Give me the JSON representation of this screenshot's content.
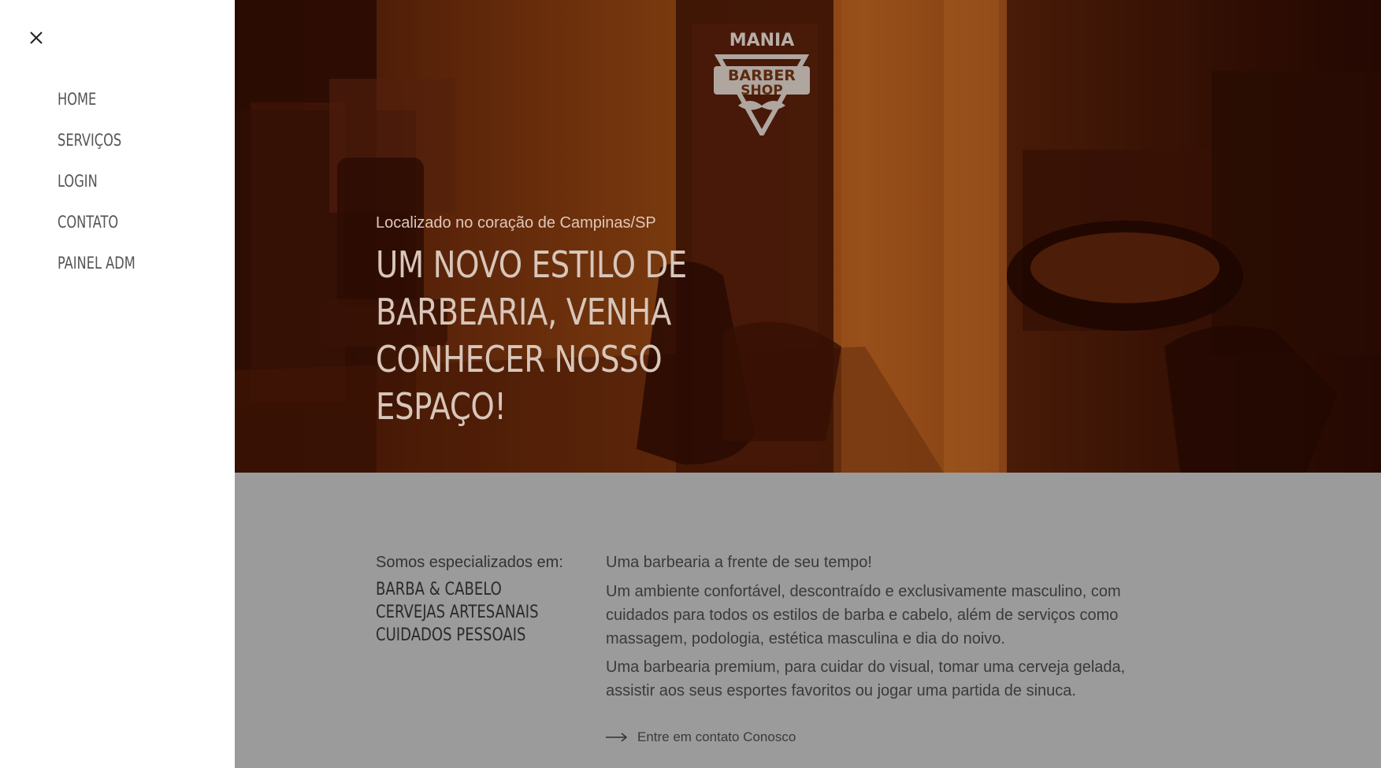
{
  "sidebar": {
    "close_icon": "close-icon",
    "items": [
      {
        "label": "HOME"
      },
      {
        "label": "SERVIÇOS"
      },
      {
        "label": "LOGIN"
      },
      {
        "label": "CONTATO"
      },
      {
        "label": "PAINEL ADM"
      }
    ]
  },
  "hero": {
    "logo_text": [
      "MANIA",
      "BARBER",
      "SHOP"
    ],
    "subtitle": "Localizado no coração de Campinas/SP",
    "title": "UM NOVO ESTILO DE BARBEARIA, VENHA CONHECER NOSSO ESPAÇO!"
  },
  "info": {
    "specialized_label": "Somos especializados em:",
    "specialties": [
      "BARBA & CABELO",
      "CERVEJAS ARTESANAIS",
      "CUIDADOS PESSOAIS"
    ],
    "lead": "Uma barbearia a frente de seu tempo!",
    "paragraph1": "Um ambiente confortável, descontraído e exclusivamente masculino, com cuidados para todos os estilos de barba e cabelo, além de serviços como massagem, podologia, estética masculina e dia do noivo.",
    "paragraph2": "Uma barbearia premium, para cuidar do visual, tomar uma cerveja gelada, assistir aos seus esportes favoritos ou jogar uma partida de sinuca.",
    "cta_label": "Entre em contato Conosco",
    "cta_icon": "arrow-right-icon"
  },
  "colors": {
    "hero_tint": "#a5561c",
    "info_bg": "#9b9b9b",
    "sidebar_bg": "#ffffff"
  }
}
